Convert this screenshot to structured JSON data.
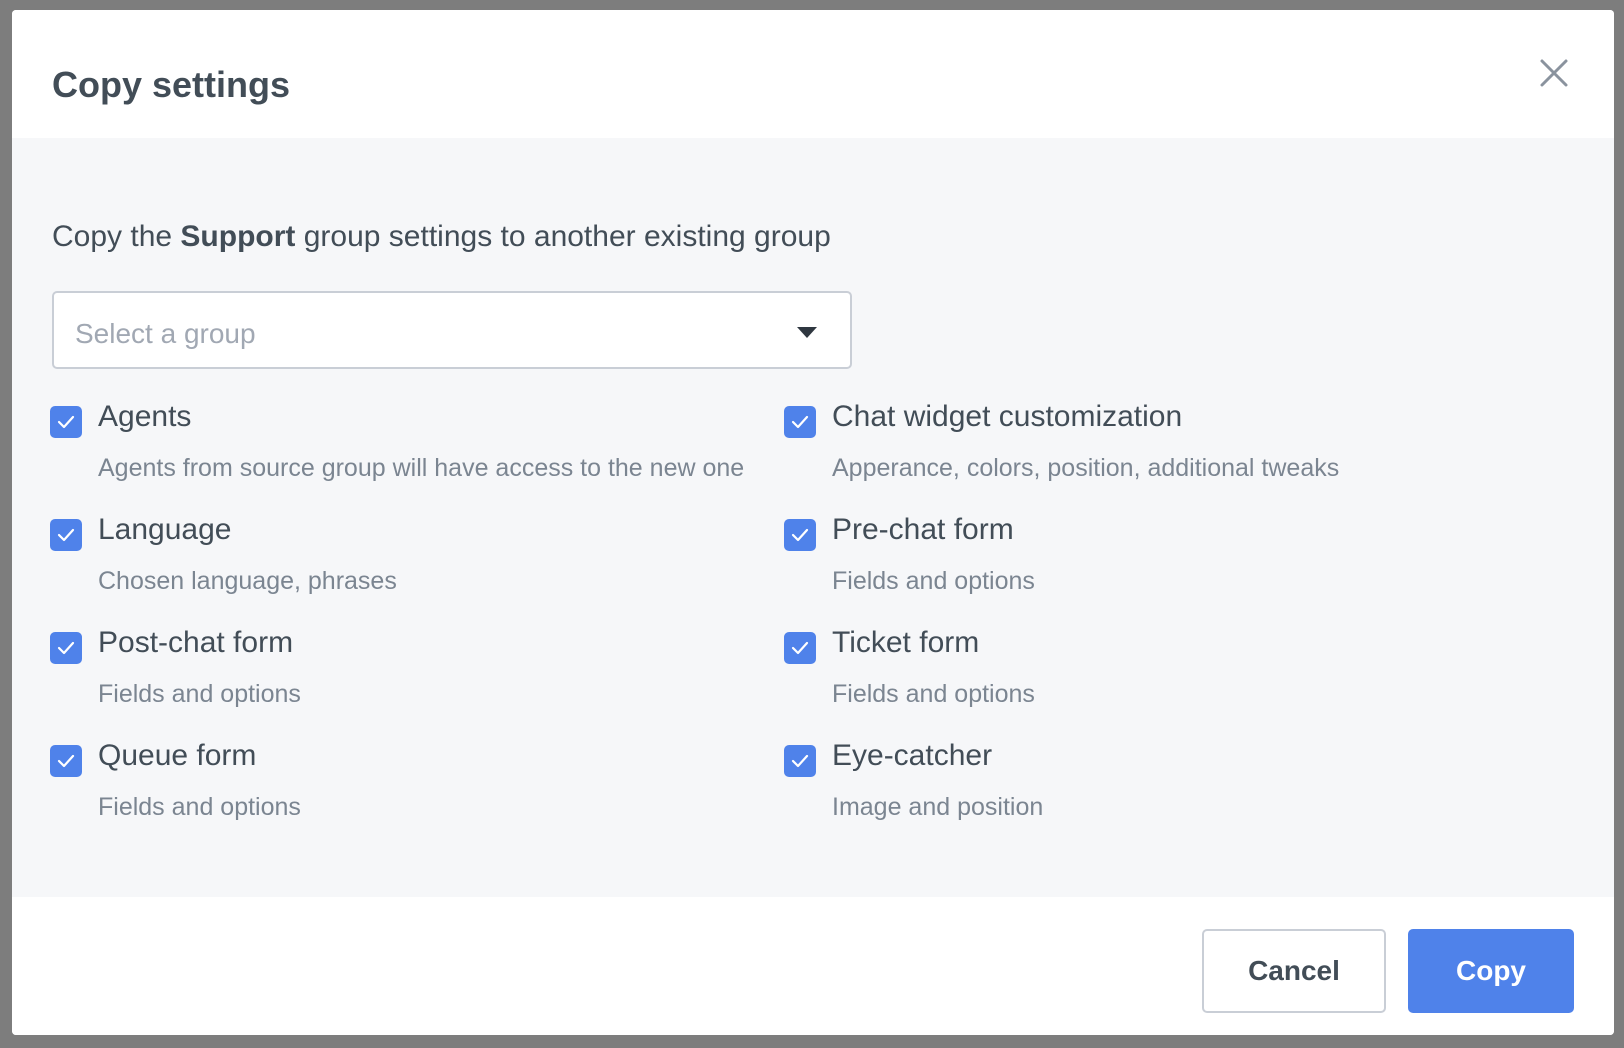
{
  "dialog": {
    "title": "Copy settings",
    "intro_prefix": "Copy the ",
    "intro_group": "Support",
    "intro_suffix": " group settings to another existing group",
    "select": {
      "placeholder": "Select a group"
    },
    "options": [
      {
        "label": "Agents",
        "description": "Agents from source group will have access to the new one",
        "checked": true
      },
      {
        "label": "Chat widget customization",
        "description": "Apperance, colors, position, additional tweaks",
        "checked": true
      },
      {
        "label": "Language",
        "description": "Chosen language, phrases",
        "checked": true
      },
      {
        "label": "Pre-chat form",
        "description": "Fields and options",
        "checked": true
      },
      {
        "label": "Post-chat form",
        "description": "Fields and options",
        "checked": true
      },
      {
        "label": "Ticket form",
        "description": "Fields and options",
        "checked": true
      },
      {
        "label": "Queue form",
        "description": "Fields and options",
        "checked": true
      },
      {
        "label": "Eye-catcher",
        "description": "Image and position",
        "checked": true
      }
    ],
    "cancel_label": "Cancel",
    "copy_label": "Copy"
  },
  "colors": {
    "accent": "#4f82ea",
    "text": "#424d57",
    "muted_text": "#7b8591",
    "body_background": "#f6f7f9",
    "overlay": "#7d7d7d"
  },
  "icons": {
    "close": "close-icon",
    "dropdown": "chevron-down-icon",
    "check": "check-icon"
  }
}
